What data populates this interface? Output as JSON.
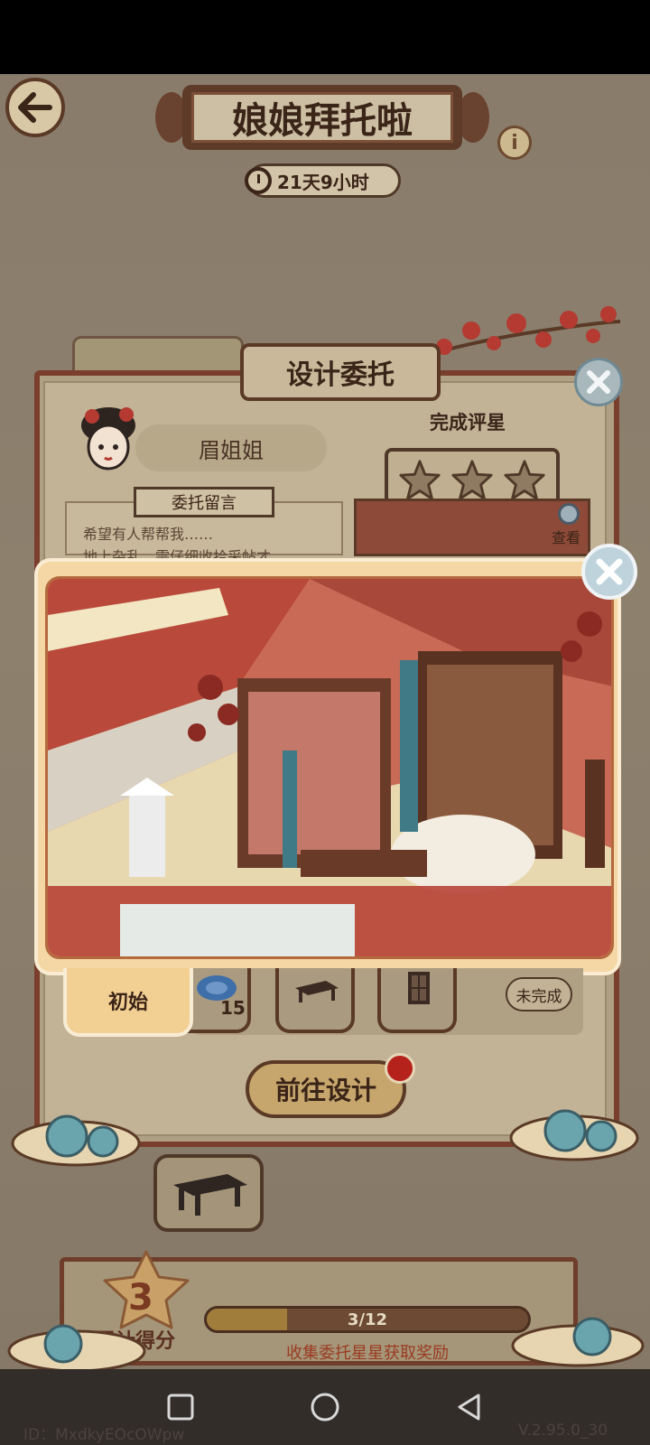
{
  "header": {
    "title": "娘娘拜托啦",
    "timer": "21天9小时",
    "info_label": "i"
  },
  "panel": {
    "section_title": "设计委托",
    "npc_name": "眉姐姐",
    "rating_label": "完成评星",
    "rating_stars": 0,
    "rating_max": 3,
    "message_title": "委托留言",
    "message_line1": "希望有人帮帮我……",
    "message_line2": "地上杂乱，需仔细收拾采帖才",
    "view_label": "查看",
    "status": "未完成",
    "go_design": "前往设计",
    "slot_count": "15"
  },
  "preview": {
    "tab_label": "初始",
    "close_label": "×"
  },
  "score": {
    "value": "3",
    "label": "累计得分",
    "progress_text": "3/12",
    "progress_value": 0.25,
    "hint": "收集委托星星获取奖励"
  },
  "footer": {
    "id_text": "ID：MxdkyEOcOWpw",
    "version": "V.2.95.0_30"
  },
  "colors": {
    "frame": "#7a3f2c",
    "paper": "#c2b397",
    "accent_red": "#b5221c"
  }
}
